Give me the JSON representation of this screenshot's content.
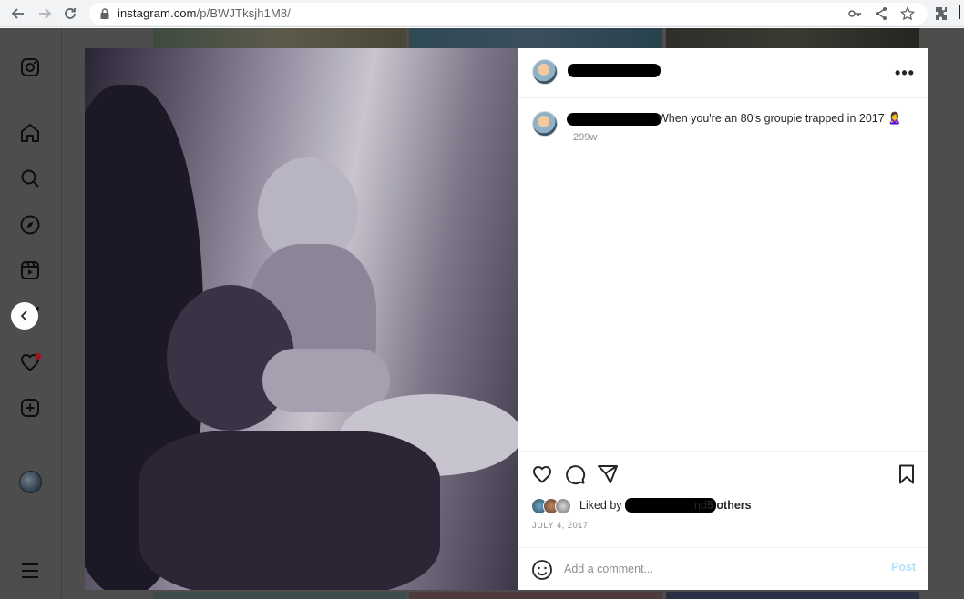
{
  "browser": {
    "url_host": "instagram.com",
    "url_path": "/p/BWJTksjh1M8/"
  },
  "rail": {
    "icons": [
      "instagram-logo-icon",
      "home-icon",
      "search-icon",
      "explore-icon",
      "reels-icon",
      "messages-icon",
      "notifications-icon",
      "create-icon",
      "profile-avatar",
      "menu-icon"
    ]
  },
  "post": {
    "caption": "When you're an 80's groupie trapped in 2017 🙎‍♀️",
    "caption_time": "299w",
    "liked_by_prefix": "Liked by",
    "liked_by_and": "nd",
    "liked_by_others": "5 others",
    "date": "JULY 4, 2017",
    "more_label": "•••"
  },
  "comment": {
    "placeholder": "Add a comment...",
    "post_label": "Post"
  },
  "colors": {
    "accent_blue_disabled": "#b2dffc",
    "overlay_gray": "#4d4d4d",
    "notification_dot": "#9b1420"
  }
}
